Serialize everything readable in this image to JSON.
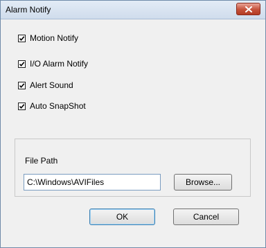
{
  "window": {
    "title": "Alarm Notify"
  },
  "options": [
    {
      "label": "Motion Notify",
      "checked": true
    },
    {
      "label": "I/O Alarm Notify",
      "checked": true
    },
    {
      "label": "Alert Sound",
      "checked": true
    },
    {
      "label": "Auto SnapShot",
      "checked": true
    }
  ],
  "file_path": {
    "label": "File Path",
    "value": "C:\\Windows\\AVIFiles",
    "browse_label": "Browse..."
  },
  "buttons": {
    "ok_label": "OK",
    "cancel_label": "Cancel"
  },
  "colors": {
    "close_button": "#c5513a",
    "title_bar": "#dce6f2"
  }
}
